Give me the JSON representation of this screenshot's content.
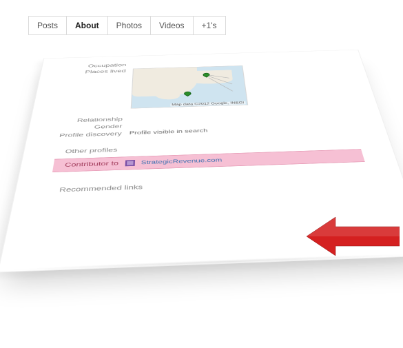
{
  "tabs": {
    "posts": "Posts",
    "about": "About",
    "photos": "Photos",
    "videos": "Videos",
    "plus1s": "+1's"
  },
  "profile": {
    "occupation_label": "Occupation",
    "places_lived_label": "Places lived",
    "relationship_label": "Relationship",
    "gender_label": "Gender",
    "profile_discovery_label": "Profile discovery",
    "profile_discovery_value": "Profile visible in search",
    "map_attrib": "Map data ©2012 Google, INEGI"
  },
  "sections": {
    "other_profiles": "Other profiles",
    "contributor_to_label": "Contributor to",
    "contributor_link": "StrategicRevenue.com",
    "recommended_links": "Recommended links"
  },
  "colors": {
    "highlight_bg": "#f6c0d4",
    "arrow": "#d42020",
    "link": "#3b6fb0",
    "pin": "#2a8c2a"
  }
}
